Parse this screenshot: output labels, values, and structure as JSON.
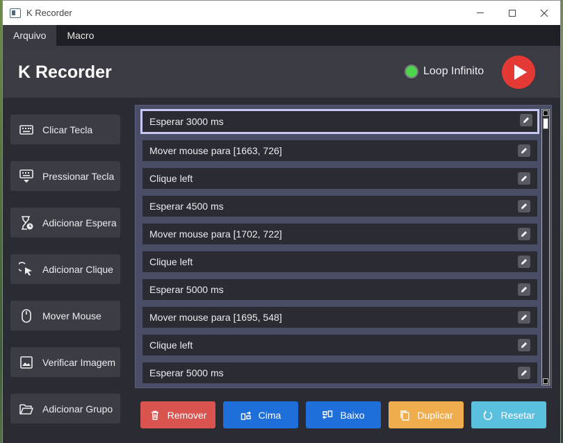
{
  "window": {
    "title": "K Recorder"
  },
  "menubar": {
    "items": [
      "Arquivo",
      "Macro"
    ]
  },
  "header": {
    "title": "K Recorder",
    "loop_label": "Loop Infinito",
    "loop_color": "#4cd44c",
    "play_color": "#e53935",
    "play_icon": "play-icon"
  },
  "sidebar": {
    "items": [
      {
        "label": "Clicar Tecla",
        "icon": "keyboard-icon"
      },
      {
        "label": "Pressionar Tecla",
        "icon": "keyboard-down-icon"
      },
      {
        "label": "Adicionar Espera",
        "icon": "hourglass-icon"
      },
      {
        "label": "Adicionar Clique",
        "icon": "cursor-click-icon"
      },
      {
        "label": "Mover Mouse",
        "icon": "mouse-icon"
      },
      {
        "label": "Verificar Imagem",
        "icon": "image-icon"
      },
      {
        "label": "Adicionar Grupo",
        "icon": "folder-open-icon"
      }
    ]
  },
  "list": {
    "items": [
      "Esperar 3000 ms",
      "Mover mouse para [1663, 726]",
      "Clique left",
      "Esperar 4500 ms",
      "Mover mouse para [1702, 722]",
      "Clique left",
      "Esperar 5000 ms",
      "Mover mouse para [1695, 548]",
      "Clique left",
      "Esperar 5000 ms"
    ],
    "selected_index": 0
  },
  "actions": [
    {
      "label": "Remover",
      "icon": "trash-icon",
      "color": "#d9534f"
    },
    {
      "label": "Cima",
      "icon": "swap-up-icon",
      "color": "#1e6fd9"
    },
    {
      "label": "Baixo",
      "icon": "swap-down-icon",
      "color": "#1e6fd9"
    },
    {
      "label": "Duplicar",
      "icon": "copy-icon",
      "color": "#f0ad4e"
    },
    {
      "label": "Resetar",
      "icon": "reset-icon",
      "color": "#5bc0de"
    }
  ]
}
